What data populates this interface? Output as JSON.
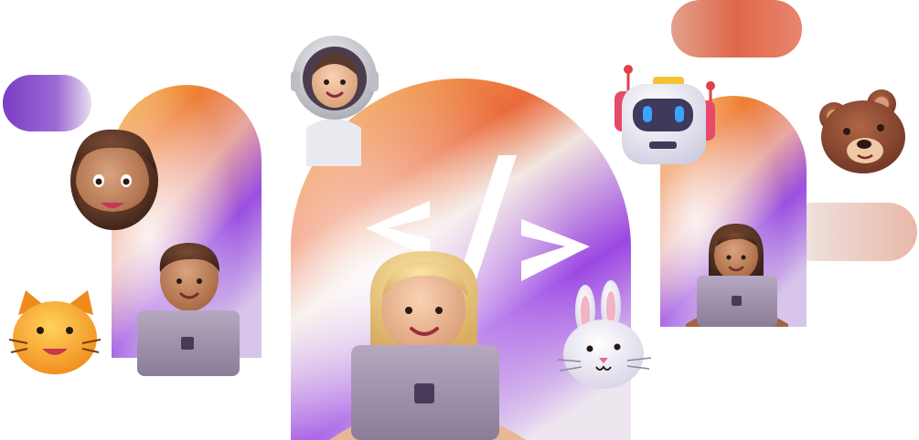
{
  "hero": {
    "code_symbol": "</>"
  },
  "colors": {
    "gradient_orange": "#f2a546",
    "gradient_deep_orange": "#e4572e",
    "gradient_purple": "#8a3ed8",
    "gradient_lilac": "#cdb7e6",
    "laptop_body": "#8f7f9b",
    "laptop_lid": "#a595b0",
    "white_glyph": "#ffffff",
    "cat_orange": "#f59e2a",
    "bear_brown": "#8b4a32",
    "robot_body": "#e8e6f3",
    "robot_eye": "#3aa3ff"
  },
  "icons": [
    "bearded-man-emoji-icon",
    "astronaut-emoji-icon",
    "robot-emoji-icon",
    "bear-face-emoji-icon",
    "cat-face-emoji-icon",
    "rabbit-face-emoji-icon",
    "developer-woman-blonde-icon",
    "developer-man-icon",
    "developer-woman-curly-icon",
    "code-brackets-icon"
  ]
}
